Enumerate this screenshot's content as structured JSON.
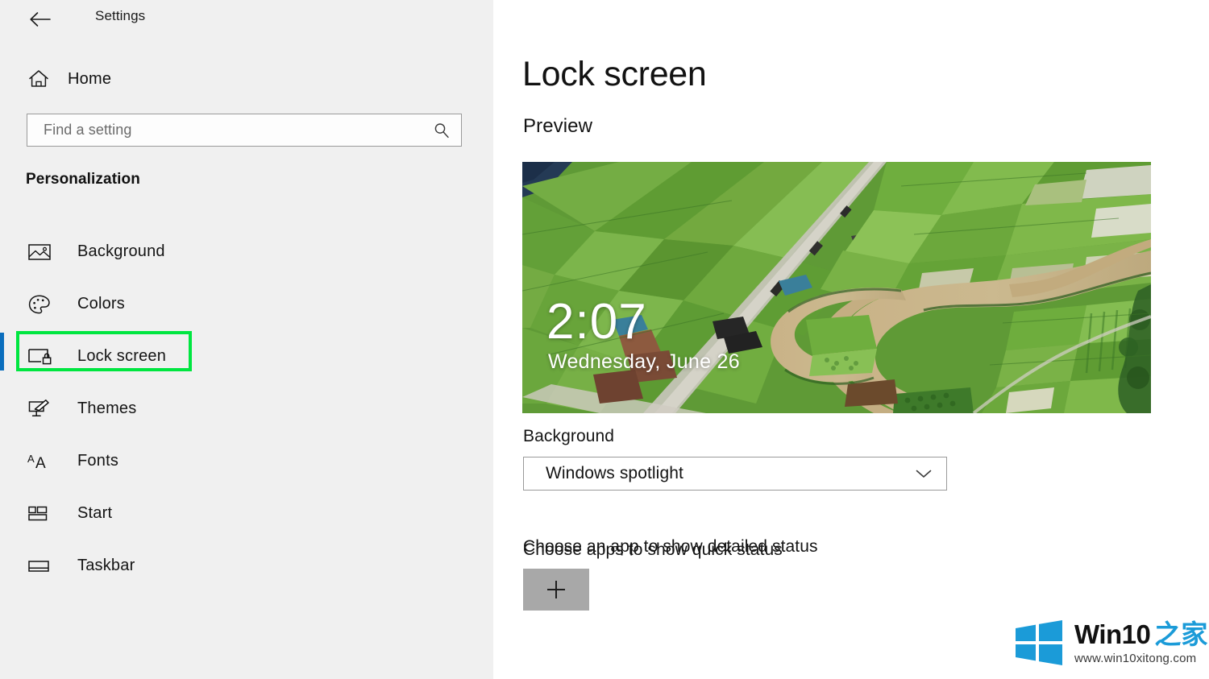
{
  "window": {
    "title": "Settings",
    "back_icon": "back-arrow-icon",
    "controls": {
      "minimize": "minimize-icon",
      "maximize": "maximize-icon",
      "close": "close-icon"
    }
  },
  "sidebar": {
    "home": {
      "label": "Home",
      "icon": "home-icon"
    },
    "search": {
      "placeholder": "Find a setting",
      "value": "",
      "icon": "search-icon"
    },
    "section_title": "Personalization",
    "items": [
      {
        "label": "Background",
        "icon": "picture-icon",
        "selected": false
      },
      {
        "label": "Colors",
        "icon": "palette-icon",
        "selected": false
      },
      {
        "label": "Lock screen",
        "icon": "lock-screen-icon",
        "selected": true
      },
      {
        "label": "Themes",
        "icon": "brush-icon",
        "selected": false
      },
      {
        "label": "Fonts",
        "icon": "font-icon",
        "selected": false
      },
      {
        "label": "Start",
        "icon": "start-tiles-icon",
        "selected": false
      },
      {
        "label": "Taskbar",
        "icon": "taskbar-icon",
        "selected": false
      }
    ],
    "selection_color": "#0b6ebd",
    "highlight_color": "#00e640"
  },
  "main": {
    "page_title": "Lock screen",
    "preview_heading": "Preview",
    "preview": {
      "time": "2:07",
      "date": "Wednesday, June 26",
      "image_description": "aerial-photo-green-fields-river"
    },
    "background": {
      "label": "Background",
      "selected": "Windows spotlight",
      "chevron_icon": "chevron-down-icon"
    },
    "detailed_status": {
      "label": "Choose an app to show detailed status",
      "add_icon": "plus-icon"
    },
    "quick_status": {
      "label": "Choose apps to show quick status"
    }
  },
  "watermark": {
    "brand": "Win10",
    "brand_cn": "之家",
    "url": "www.win10xitong.com",
    "logo_color": "#1b9bd8"
  }
}
